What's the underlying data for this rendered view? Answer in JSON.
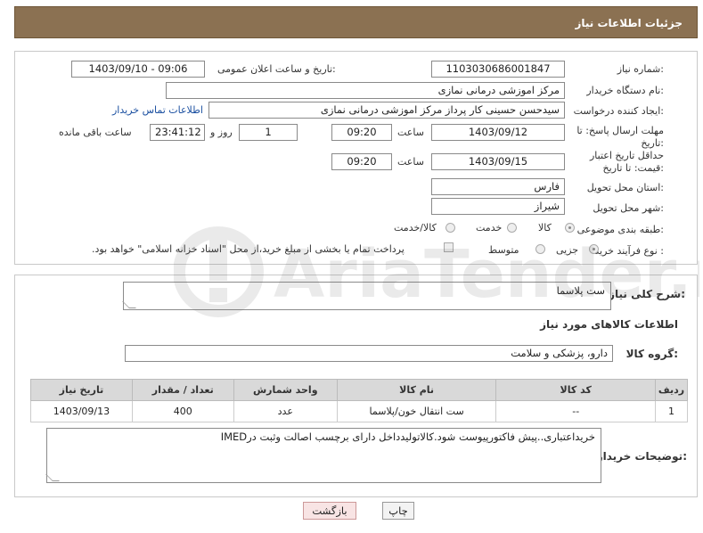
{
  "header": {
    "title": "جزئیات اطلاعات نیاز"
  },
  "fields": {
    "need_number_label": "شماره نیاز:",
    "need_number": "1103030686001847",
    "announce_label": "تاریخ و ساعت اعلان عمومی:",
    "announce_value": "1403/09/10 - 09:06",
    "buyer_org_label": "نام دستگاه خریدار:",
    "buyer_org": "مرکز اموزشی درمانی نمازی",
    "creator_label": "ایجاد کننده درخواست:",
    "creator": "سیدحسن حسینی کار پرداز مرکز اموزشی درمانی نمازی",
    "contact_link": "اطلاعات تماس خریدار",
    "reply_deadline_label": "مهلت ارسال پاسخ: تا تاریخ:",
    "reply_date": "1403/09/12",
    "time_label": "ساعت",
    "reply_time": "09:20",
    "days_value": "1",
    "days_label": "روز و",
    "remaining_value": "23:41:12",
    "remaining_label": "ساعت باقی مانده",
    "price_deadline_label": "حداقل تاریخ اعتبار قیمت: تا تاریخ:",
    "price_date": "1403/09/15",
    "price_time": "09:20",
    "province_label": "استان محل تحویل:",
    "province": "فارس",
    "city_label": "شهر محل تحویل:",
    "city": "شیراز",
    "category_label": "طبقه بندی موضوعی:",
    "category_options": [
      "کالا",
      "خدمت",
      "کالا/خدمت"
    ],
    "purchase_type_label": "نوع فرآیند خرید :",
    "purchase_options": [
      "جزیی",
      "متوسط"
    ],
    "payment_note": "پرداخت تمام یا بخشی از مبلغ خرید،از محل \"اسناد خزانه اسلامی\" خواهد بود."
  },
  "summary": {
    "label": "شرح کلی نیاز:",
    "value": "ست پلاسما"
  },
  "goods": {
    "section_title": "اطلاعات کالاهای مورد نیاز",
    "group_label": "گروه کالا:",
    "group_value": "دارو، پزشکی و سلامت",
    "columns": [
      "ردیف",
      "کد کالا",
      "نام کالا",
      "واحد شمارش",
      "تعداد / مقدار",
      "تاریخ نیاز"
    ],
    "rows": [
      [
        "1",
        "--",
        "ست انتقال خون/پلاسما",
        "عدد",
        "400",
        "1403/09/13"
      ]
    ]
  },
  "buyer_notes": {
    "label": "توضیحات خریدار:",
    "value": "خریداعتباری..پیش فاکتورپیوست شود.کالاتولیدداخل دارای برچسب اصالت وثبت درIMED"
  },
  "buttons": {
    "print": "چاپ",
    "back": "بازگشت"
  },
  "watermark": "AriaTender.net",
  "colors": {
    "header": "#8b7152",
    "link": "#1a4fa0"
  }
}
